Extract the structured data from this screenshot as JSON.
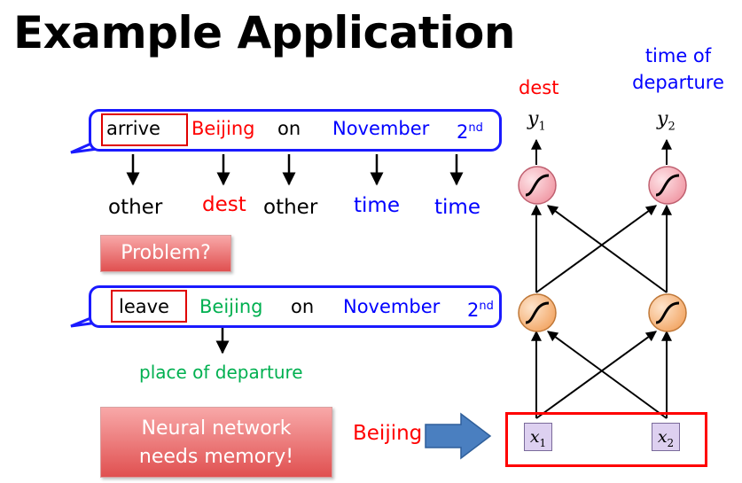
{
  "title": "Example Application",
  "sentence1": {
    "words": [
      "arrive",
      "Beijing",
      "on",
      "November",
      "2"
    ],
    "sup": "nd",
    "tags": [
      "other",
      "dest",
      "other",
      "time",
      "time"
    ]
  },
  "problem_label": "Problem?",
  "sentence2": {
    "words": [
      "leave",
      "Beijing",
      "on",
      "November",
      "2"
    ],
    "sup": "nd",
    "tag": "place of departure"
  },
  "memory_note": {
    "line1": "Neural network",
    "line2": "needs memory!"
  },
  "input_word": "Beijing",
  "network": {
    "out1_label": "dest",
    "out2_label_line1": "time of",
    "out2_label_line2": "departure",
    "y1": "y",
    "y1_sub": "1",
    "y2": "y",
    "y2_sub": "2",
    "x1": "x",
    "x1_sub": "1",
    "x2": "x",
    "x2_sub": "2"
  },
  "colors": {
    "accent_blue": "#0000ff",
    "accent_red": "#ff0000",
    "accent_green": "#00b050",
    "output_neuron": "#f7b0b8",
    "hidden_neuron": "#f8c090",
    "input_box": "#ddd0f0",
    "arrow_blue": "#4a7fc0"
  }
}
